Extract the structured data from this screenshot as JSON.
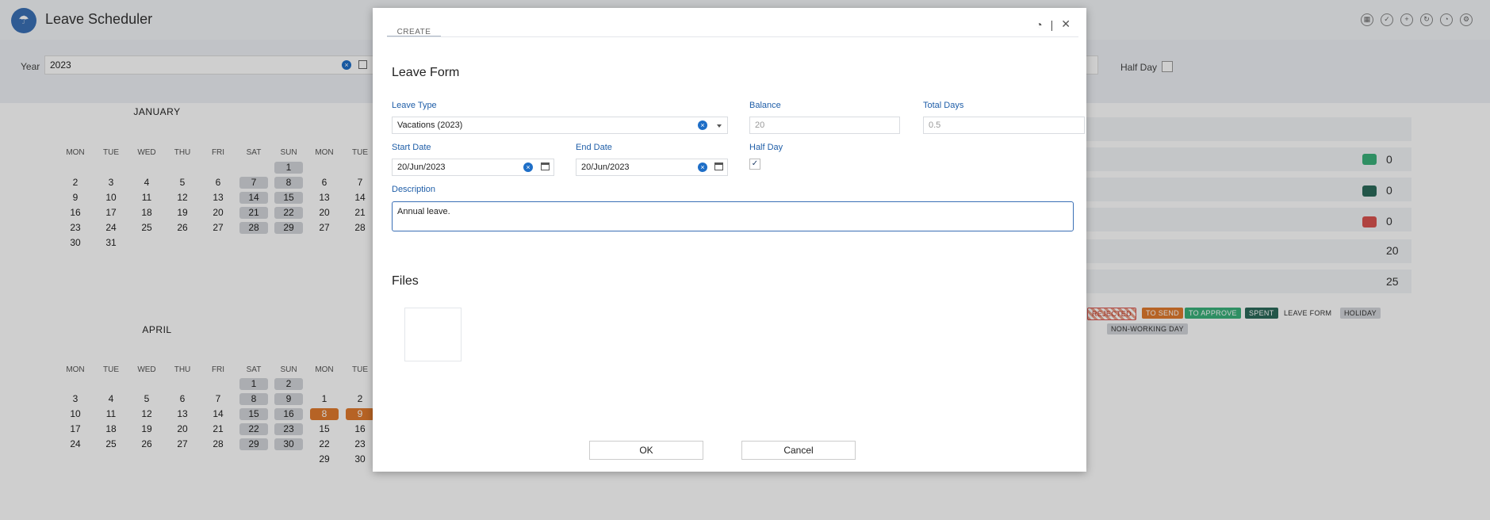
{
  "app": {
    "title": "Leave Scheduler"
  },
  "filters": {
    "year_label": "Year",
    "year_value": "2023",
    "half_day_label": "Half Day"
  },
  "calendar": {
    "day_names": [
      "MON",
      "TUE",
      "WED",
      "THU",
      "FRI",
      "SAT",
      "SUN"
    ],
    "january": {
      "title": "JANUARY",
      "rows": [
        [
          "",
          "",
          "",
          "",
          "",
          "",
          "1"
        ],
        [
          "2",
          "3",
          "4",
          "5",
          "6",
          "7",
          "8"
        ],
        [
          "9",
          "10",
          "11",
          "12",
          "13",
          "14",
          "15"
        ],
        [
          "16",
          "17",
          "18",
          "19",
          "20",
          "21",
          "22"
        ],
        [
          "23",
          "24",
          "25",
          "26",
          "27",
          "28",
          "29"
        ],
        [
          "30",
          "31",
          "",
          "",
          "",
          "",
          ""
        ]
      ]
    },
    "february_partial": {
      "rows": [
        [
          "",
          ""
        ],
        [
          "6",
          "7"
        ],
        [
          "13",
          "14"
        ],
        [
          "20",
          "21"
        ],
        [
          "27",
          "28"
        ]
      ]
    },
    "april": {
      "title": "APRIL",
      "rows": [
        [
          "",
          "",
          "",
          "",
          "",
          "1",
          "2"
        ],
        [
          "3",
          "4",
          "5",
          "6",
          "7",
          "8",
          "9"
        ],
        [
          "10",
          "11",
          "12",
          "13",
          "14",
          "15",
          "16"
        ],
        [
          "17",
          "18",
          "19",
          "20",
          "21",
          "22",
          "23"
        ],
        [
          "24",
          "25",
          "26",
          "27",
          "28",
          "29",
          "30"
        ]
      ]
    },
    "may_partial": {
      "rows": [
        [
          "1",
          "2"
        ],
        [
          "8",
          "9"
        ],
        [
          "15",
          "16"
        ],
        [
          "22",
          "23"
        ],
        [
          "29",
          "30"
        ]
      ]
    }
  },
  "summary": {
    "values": [
      "0",
      "0",
      "0",
      "20",
      "25"
    ],
    "colors": [
      "#3bb07a",
      "#2c6a5a",
      "#d9534f"
    ]
  },
  "legend": {
    "items": [
      "REJECTED",
      "TO SEND",
      "TO APPROVE",
      "SPENT",
      "LEAVE FORM",
      "HOLIDAY",
      "NON-WORKING DAY"
    ]
  },
  "modal": {
    "tab_label": "CREATE",
    "form_title": "Leave Form",
    "leave_type": {
      "label": "Leave Type",
      "value": "Vacations (2023)"
    },
    "balance": {
      "label": "Balance",
      "value": "20"
    },
    "total_days": {
      "label": "Total Days",
      "value": "0.5"
    },
    "start_date": {
      "label": "Start Date",
      "value": "20/Jun/2023"
    },
    "end_date": {
      "label": "End Date",
      "value": "20/Jun/2023"
    },
    "half_day": {
      "label": "Half Day",
      "checked": true
    },
    "description": {
      "label": "Description",
      "value": "Annual leave."
    },
    "files_title": "Files",
    "ok_label": "OK",
    "cancel_label": "Cancel"
  }
}
